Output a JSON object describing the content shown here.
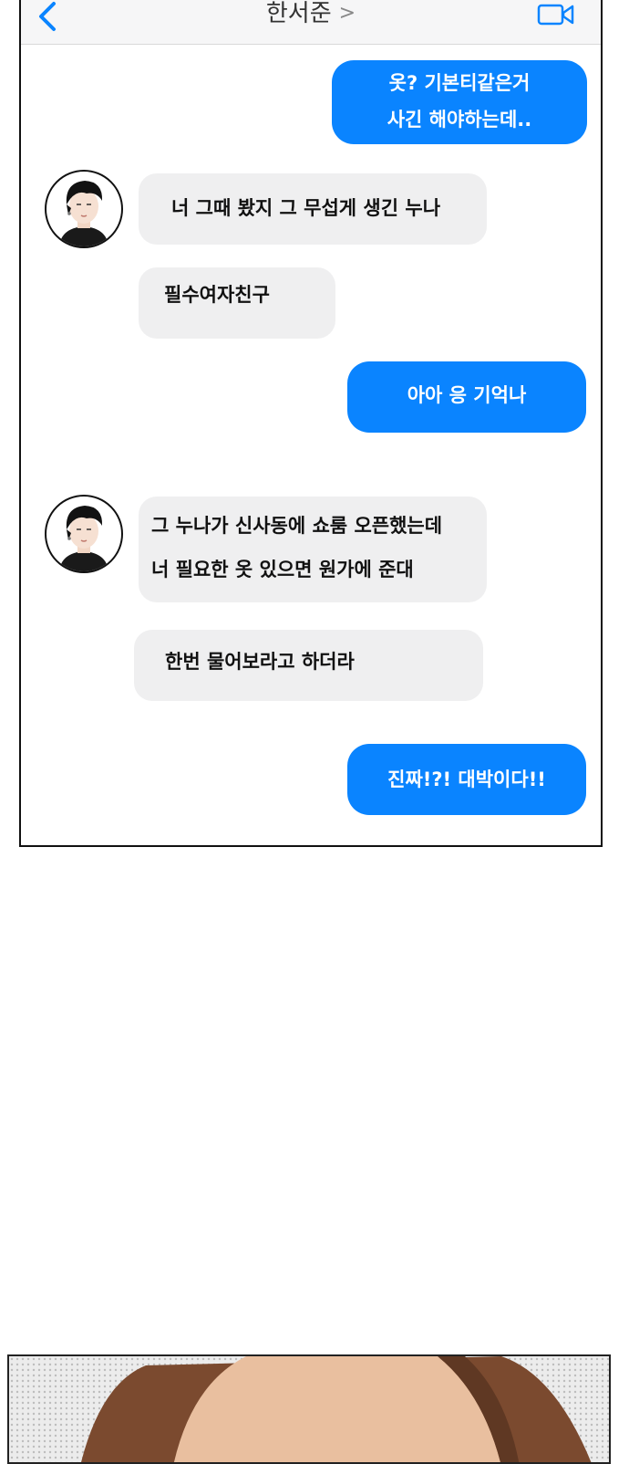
{
  "header": {
    "contact_name": "한서준",
    "back_icon": "chevron-left-icon",
    "chevron_icon": "chevron-right-icon",
    "video_icon": "video-call-icon",
    "accent_color": "#0a84ff"
  },
  "messages": [
    {
      "side": "sent",
      "lines": [
        "옷? 기본티같은거",
        "사긴 해야하는데.."
      ]
    },
    {
      "side": "received",
      "lines": [
        "너 그때 봤지 그 무섭게 생긴 누나"
      ]
    },
    {
      "side": "received",
      "lines": [
        "필수여자친구"
      ]
    },
    {
      "side": "sent",
      "lines": [
        "아아 응 기억나"
      ]
    },
    {
      "side": "received",
      "lines": [
        "그 누나가 신사동에 쇼룸 오픈했는데",
        "너 필요한 옷 있으면 원가에 준대"
      ]
    },
    {
      "side": "received",
      "lines": [
        "한번 물어보라고 하더라"
      ]
    },
    {
      "side": "sent",
      "lines": [
        "진짜!?! 대박이다!!"
      ]
    }
  ],
  "colors": {
    "sent_bubble": "#0a84ff",
    "received_bubble": "#efeff0"
  }
}
